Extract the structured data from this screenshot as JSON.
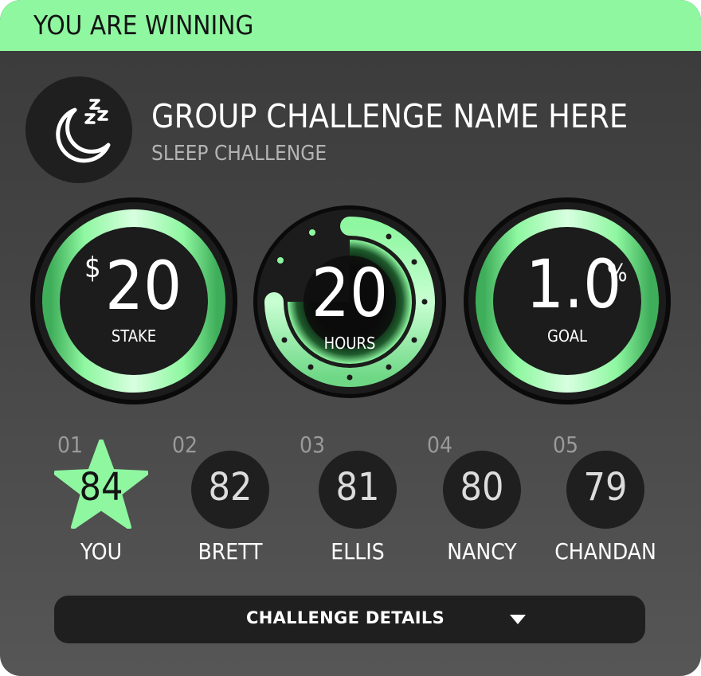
{
  "banner": {
    "text": "YOU ARE WINNING",
    "color": "#8ef7a0"
  },
  "challenge": {
    "title": "GROUP CHALLENGE NAME HERE",
    "type": "SLEEP CHALLENGE",
    "icon": "moon-zzz-icon"
  },
  "stats": {
    "stake": {
      "currency": "$",
      "value": "20",
      "label": "STAKE"
    },
    "hours": {
      "value": "20",
      "label": "HOURS"
    },
    "goal": {
      "value": "1.0",
      "unit": "%",
      "label": "GOAL"
    }
  },
  "leaderboard": [
    {
      "rank": "01",
      "score": "84",
      "name": "YOU",
      "highlight": true
    },
    {
      "rank": "02",
      "score": "82",
      "name": "BRETT"
    },
    {
      "rank": "03",
      "score": "81",
      "name": "ELLIS"
    },
    {
      "rank": "04",
      "score": "80",
      "name": "NANCY"
    },
    {
      "rank": "05",
      "score": "79",
      "name": "CHANDAN"
    }
  ],
  "details_button": {
    "label": "CHALLENGE DETAILS",
    "icon": "caret-down-icon"
  },
  "colors": {
    "accent": "#8ef7a0",
    "dark": "#1f1f1f"
  }
}
